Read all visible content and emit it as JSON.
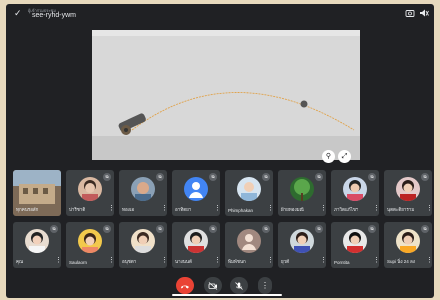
{
  "top_bar": {
    "tiny_label": "ผู้เข้าร่วมประชุม",
    "meeting_code": "see-ryhd-ywm",
    "chevron_icon": "chevron-down-icon",
    "camera_switch_icon": "camera-switch-icon",
    "speaker_icon": "speaker-muted-icon"
  },
  "presentation": {
    "description_icons": [
      "pin-icon",
      "fullscreen-icon"
    ]
  },
  "participants": [
    {
      "name": "ทุกคนรอสัก",
      "avatar": "building-photo"
    },
    {
      "name": "ปาริชาติ",
      "avatar": "child-photo"
    },
    {
      "name": "ทองเอ",
      "avatar": "child-photo-2"
    },
    {
      "name": "อาทิตยา",
      "avatar": "default-person"
    },
    {
      "name": "Phimphakan",
      "avatar": "child-photo-3"
    },
    {
      "name": "ฝ้ายทองมณี",
      "avatar": "tree-photo"
    },
    {
      "name": "ภาวิตแก้ไขฯ",
      "avatar": "child-photo-4"
    },
    {
      "name": "นุตตะติยาราม",
      "avatar": "child-photo-5"
    },
    {
      "name": "คุณ",
      "avatar": "child-photo-6"
    },
    {
      "name": "Saulaorn",
      "avatar": "child-photo-7"
    },
    {
      "name": "อนุชตา",
      "avatar": "child-photo-8"
    },
    {
      "name": "นางนนต์",
      "avatar": "child-photo-9"
    },
    {
      "name": "พิมพ์ชนก",
      "avatar": "default-person-2"
    },
    {
      "name": "ยุวดี",
      "avatar": "child-photo-10"
    },
    {
      "name": "Porntita",
      "avatar": "child-photo-11"
    },
    {
      "name": "Supi นิ่ง 24 ลง",
      "avatar": "child-photo-12"
    }
  ],
  "controls": {
    "end_call_icon": "end-call-icon",
    "camera_off_icon": "camera-off-icon",
    "mic_off_icon": "mic-off-icon",
    "more_icon": "more-vert-icon"
  }
}
